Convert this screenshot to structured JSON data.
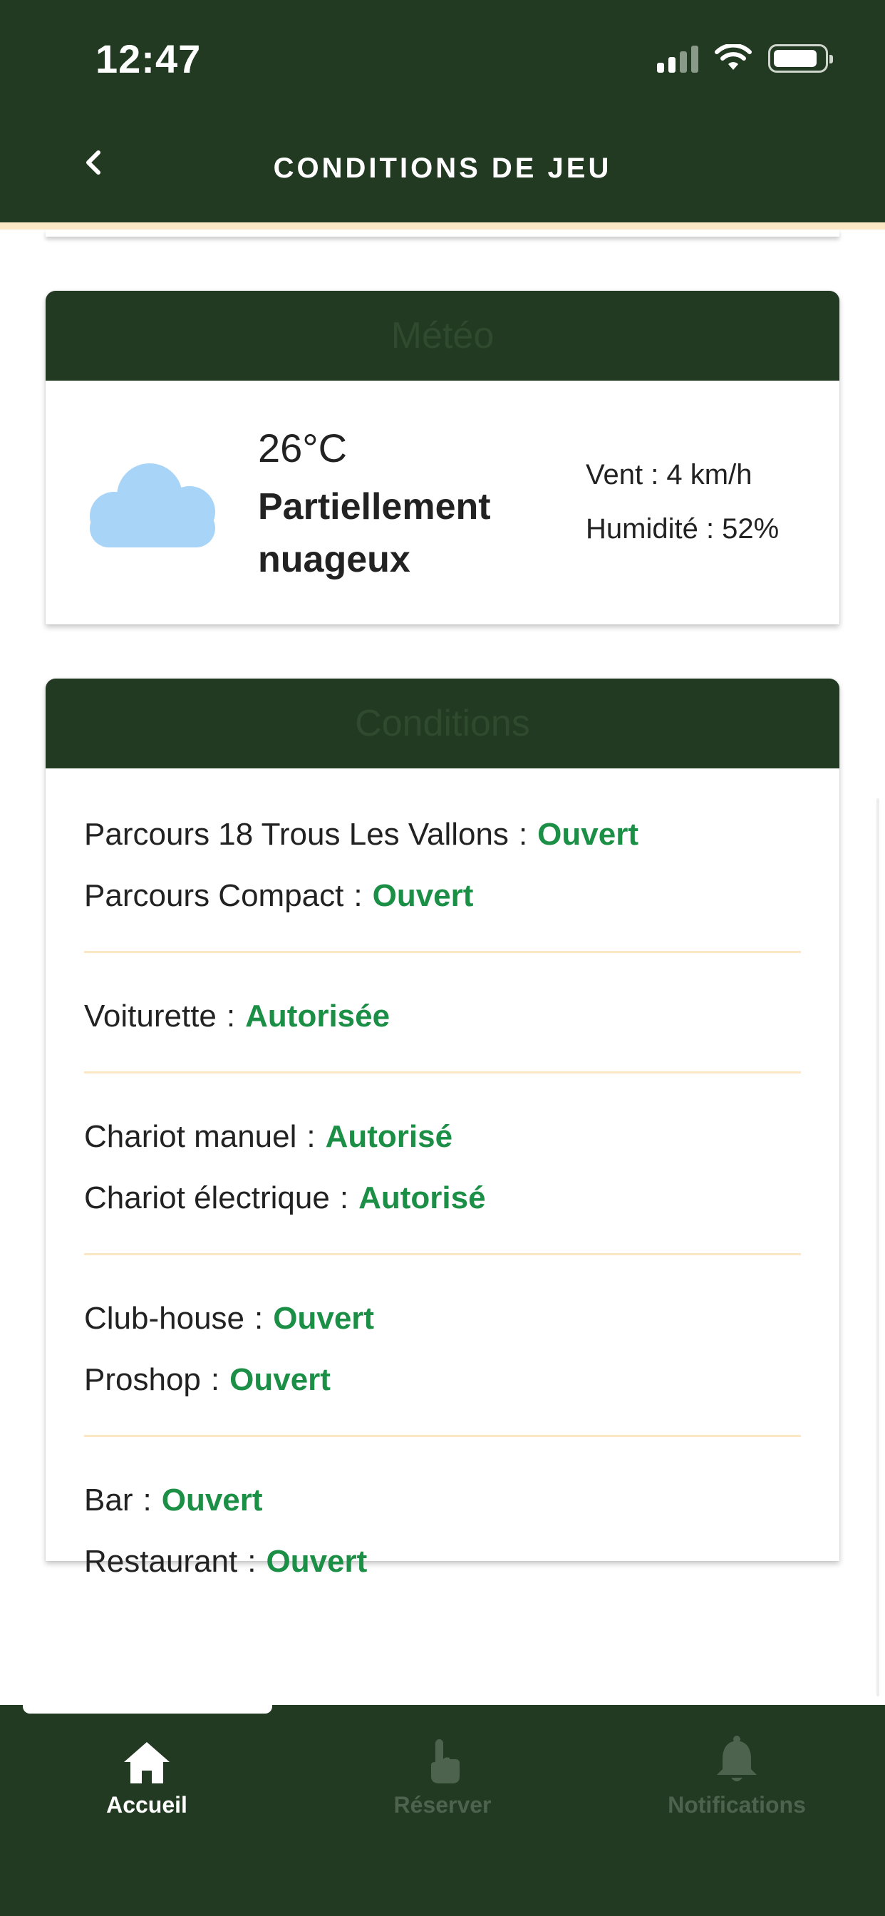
{
  "status_bar": {
    "time": "12:47"
  },
  "header": {
    "title": "CONDITIONS DE JEU"
  },
  "weather": {
    "section_title": "Météo",
    "temperature": "26°C",
    "condition": "Partiellement nuageux",
    "wind": "Vent : 4 km/h",
    "humidity": "Humidité : 52%",
    "icon": "cloud-icon"
  },
  "conditions": {
    "section_title": "Conditions",
    "groups": [
      {
        "rows": [
          {
            "label": "Parcours 18 Trous Les Vallons",
            "sep": ":",
            "value": "Ouvert"
          },
          {
            "label": "Parcours Compact",
            "sep": ":",
            "value": "Ouvert"
          }
        ]
      },
      {
        "rows": [
          {
            "label": "Voiturette",
            "sep": ":",
            "value": "Autorisée"
          }
        ]
      },
      {
        "rows": [
          {
            "label": "Chariot manuel",
            "sep": ":",
            "value": "Autorisé"
          },
          {
            "label": "Chariot électrique",
            "sep": ":",
            "value": "Autorisé"
          }
        ]
      },
      {
        "rows": [
          {
            "label": "Club-house",
            "sep": ":",
            "value": "Ouvert"
          },
          {
            "label": "Proshop",
            "sep": ":",
            "value": "Ouvert"
          }
        ]
      },
      {
        "rows": [
          {
            "label": "Bar",
            "sep": ":",
            "value": "Ouvert"
          },
          {
            "label": "Restaurant",
            "sep": ":",
            "value": "Ouvert"
          }
        ]
      }
    ]
  },
  "tabbar": {
    "tabs": [
      {
        "label": "Accueil",
        "icon": "home-icon",
        "active": true
      },
      {
        "label": "Réserver",
        "icon": "tap-hand-icon",
        "active": false
      },
      {
        "label": "Notifications",
        "icon": "bell-icon",
        "active": false
      }
    ]
  },
  "colors": {
    "primary_dark_green": "#223a21",
    "accent_cream": "#fbe7c4",
    "status_green": "#1a8f45",
    "cloud_blue": "#a8d4f7"
  }
}
